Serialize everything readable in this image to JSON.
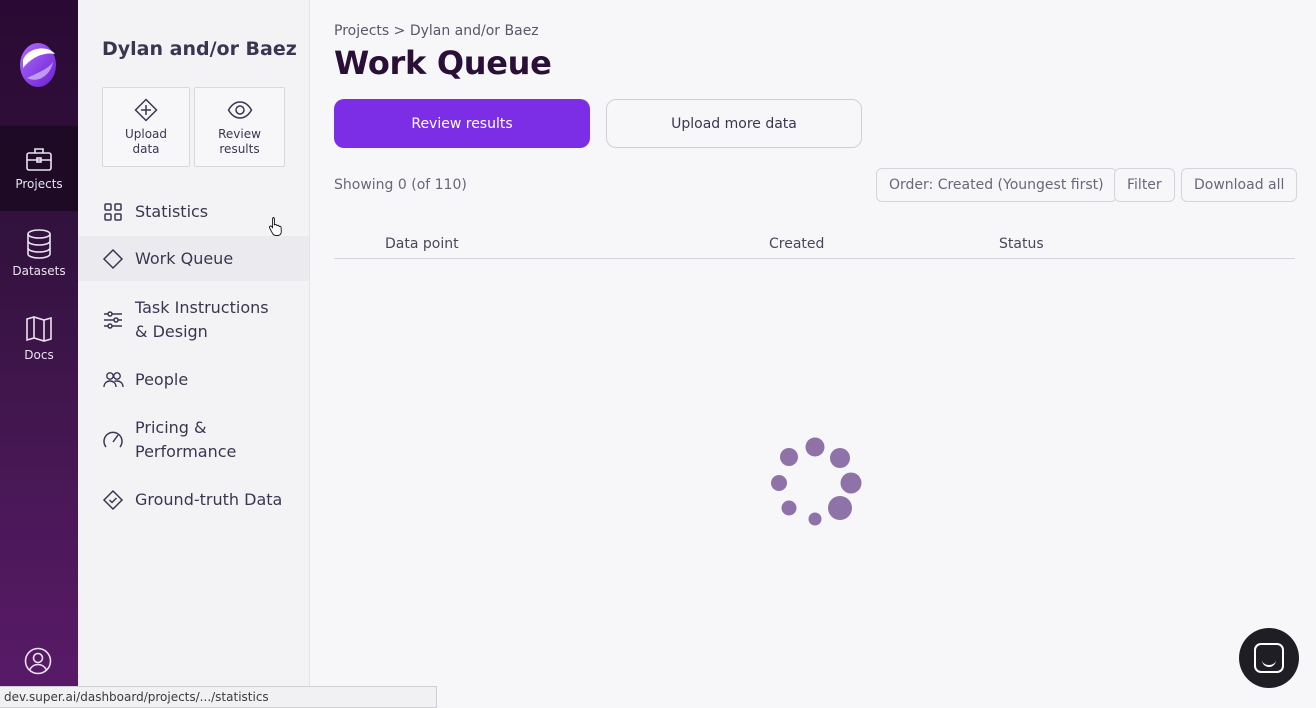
{
  "rail": {
    "items": [
      {
        "label": "Projects",
        "icon": "briefcase-icon"
      },
      {
        "label": "Datasets",
        "icon": "database-icon"
      },
      {
        "label": "Docs",
        "icon": "book-icon"
      }
    ]
  },
  "sidenav": {
    "project_name": "Dylan and/or Baez",
    "quick_actions": [
      {
        "label": "Upload data",
        "icon": "upload-icon"
      },
      {
        "label": "Review results",
        "icon": "eye-icon"
      }
    ],
    "items": [
      {
        "label": "Statistics",
        "icon": "grid-icon"
      },
      {
        "label": "Work Queue",
        "icon": "diamond-icon",
        "active": true
      },
      {
        "label": "Task Instructions & Design",
        "icon": "sliders-icon"
      },
      {
        "label": "People",
        "icon": "people-icon"
      },
      {
        "label": "Pricing & Performance",
        "icon": "gauge-icon"
      },
      {
        "label": "Ground-truth Data",
        "icon": "check-diamond-icon"
      }
    ]
  },
  "main": {
    "breadcrumb": "Projects > Dylan and/or Baez",
    "title": "Work Queue",
    "primary_button": "Review results",
    "secondary_button": "Upload more data",
    "showing": "Showing 0 (of 110)",
    "order_button": "Order: Created (Youngest first)",
    "filter_button": "Filter",
    "download_button": "Download all",
    "columns": [
      "Data point",
      "Created",
      "Status"
    ]
  },
  "statusbar": "dev.super.ai/dashboard/projects/.../statistics",
  "colors": {
    "accent": "#7b2ee6",
    "rail": "#2a0a33",
    "spinner": "#8e72a8"
  }
}
